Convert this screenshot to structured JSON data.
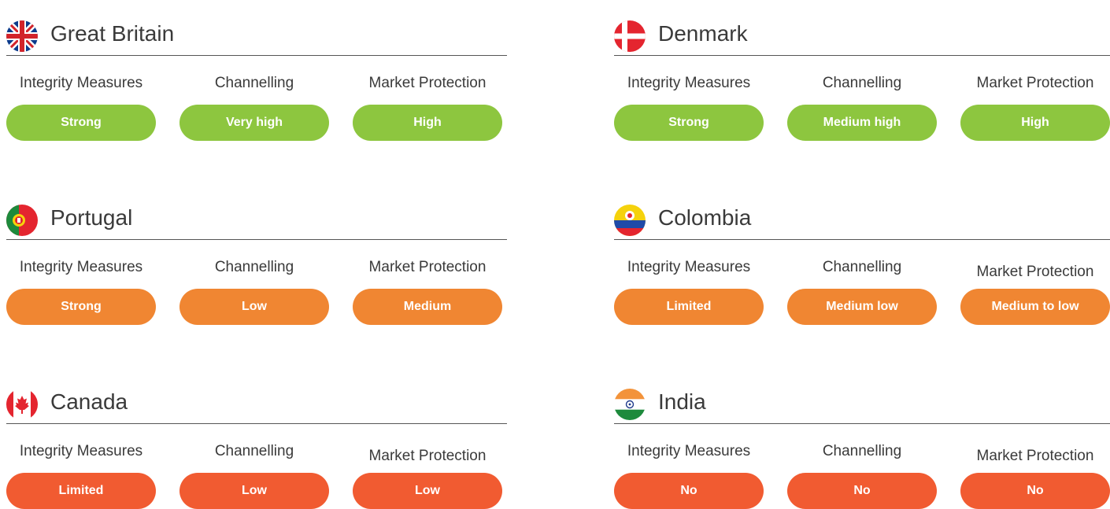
{
  "colors": {
    "green": "#8dc63f",
    "orange": "#f08632",
    "red": "#f15b31",
    "text": "#3a3a3a"
  },
  "labels": {
    "integrity": "Integrity Measures",
    "channelling": "Channelling",
    "market": "Market Protection"
  },
  "countries": [
    {
      "name": "Great Britain",
      "flag": "gb-flag-icon",
      "integrity": "Strong",
      "channelling": "Very high",
      "market": "High",
      "color": "green"
    },
    {
      "name": "Denmark",
      "flag": "dk-flag-icon",
      "integrity": "Strong",
      "channelling": "Medium high",
      "market": "High",
      "color": "green"
    },
    {
      "name": "Portugal",
      "flag": "pt-flag-icon",
      "integrity": "Strong",
      "channelling": "Low",
      "market": "Medium",
      "color": "orange"
    },
    {
      "name": "Colombia",
      "flag": "co-flag-icon",
      "integrity": "Limited",
      "channelling": "Medium low",
      "market": "Medium to low",
      "color": "orange"
    },
    {
      "name": "Canada",
      "flag": "ca-flag-icon",
      "integrity": "Limited",
      "channelling": "Low",
      "market": "Low",
      "color": "red"
    },
    {
      "name": "India",
      "flag": "in-flag-icon",
      "integrity": "No",
      "channelling": "No",
      "market": "No",
      "color": "red"
    }
  ]
}
